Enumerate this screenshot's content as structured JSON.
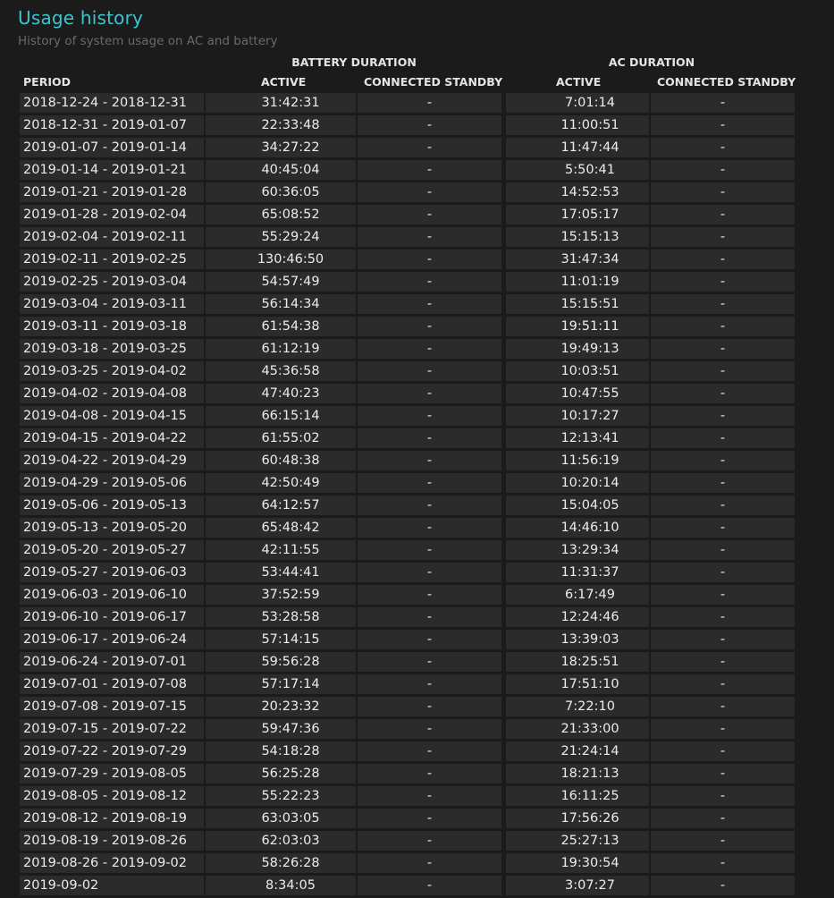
{
  "header": {
    "title": "Usage history",
    "subtitle": "History of system usage on AC and battery"
  },
  "table": {
    "group_battery": "BATTERY DURATION",
    "group_ac": "AC DURATION",
    "columns": {
      "period": "PERIOD",
      "battery_active": "ACTIVE",
      "battery_standby": "CONNECTED STANDBY",
      "ac_active": "ACTIVE",
      "ac_standby": "CONNECTED STANDBY"
    },
    "rows": [
      {
        "period": "2018-12-24 - 2018-12-31",
        "battery_active": "31:42:31",
        "battery_standby": "-",
        "ac_active": "7:01:14",
        "ac_standby": "-"
      },
      {
        "period": "2018-12-31 - 2019-01-07",
        "battery_active": "22:33:48",
        "battery_standby": "-",
        "ac_active": "11:00:51",
        "ac_standby": "-"
      },
      {
        "period": "2019-01-07 - 2019-01-14",
        "battery_active": "34:27:22",
        "battery_standby": "-",
        "ac_active": "11:47:44",
        "ac_standby": "-"
      },
      {
        "period": "2019-01-14 - 2019-01-21",
        "battery_active": "40:45:04",
        "battery_standby": "-",
        "ac_active": "5:50:41",
        "ac_standby": "-"
      },
      {
        "period": "2019-01-21 - 2019-01-28",
        "battery_active": "60:36:05",
        "battery_standby": "-",
        "ac_active": "14:52:53",
        "ac_standby": "-"
      },
      {
        "period": "2019-01-28 - 2019-02-04",
        "battery_active": "65:08:52",
        "battery_standby": "-",
        "ac_active": "17:05:17",
        "ac_standby": "-"
      },
      {
        "period": "2019-02-04 - 2019-02-11",
        "battery_active": "55:29:24",
        "battery_standby": "-",
        "ac_active": "15:15:13",
        "ac_standby": "-"
      },
      {
        "period": "2019-02-11 - 2019-02-25",
        "battery_active": "130:46:50",
        "battery_standby": "-",
        "ac_active": "31:47:34",
        "ac_standby": "-"
      },
      {
        "period": "2019-02-25 - 2019-03-04",
        "battery_active": "54:57:49",
        "battery_standby": "-",
        "ac_active": "11:01:19",
        "ac_standby": "-"
      },
      {
        "period": "2019-03-04 - 2019-03-11",
        "battery_active": "56:14:34",
        "battery_standby": "-",
        "ac_active": "15:15:51",
        "ac_standby": "-"
      },
      {
        "period": "2019-03-11 - 2019-03-18",
        "battery_active": "61:54:38",
        "battery_standby": "-",
        "ac_active": "19:51:11",
        "ac_standby": "-"
      },
      {
        "period": "2019-03-18 - 2019-03-25",
        "battery_active": "61:12:19",
        "battery_standby": "-",
        "ac_active": "19:49:13",
        "ac_standby": "-"
      },
      {
        "period": "2019-03-25 - 2019-04-02",
        "battery_active": "45:36:58",
        "battery_standby": "-",
        "ac_active": "10:03:51",
        "ac_standby": "-"
      },
      {
        "period": "2019-04-02 - 2019-04-08",
        "battery_active": "47:40:23",
        "battery_standby": "-",
        "ac_active": "10:47:55",
        "ac_standby": "-"
      },
      {
        "period": "2019-04-08 - 2019-04-15",
        "battery_active": "66:15:14",
        "battery_standby": "-",
        "ac_active": "10:17:27",
        "ac_standby": "-"
      },
      {
        "period": "2019-04-15 - 2019-04-22",
        "battery_active": "61:55:02",
        "battery_standby": "-",
        "ac_active": "12:13:41",
        "ac_standby": "-"
      },
      {
        "period": "2019-04-22 - 2019-04-29",
        "battery_active": "60:48:38",
        "battery_standby": "-",
        "ac_active": "11:56:19",
        "ac_standby": "-"
      },
      {
        "period": "2019-04-29 - 2019-05-06",
        "battery_active": "42:50:49",
        "battery_standby": "-",
        "ac_active": "10:20:14",
        "ac_standby": "-"
      },
      {
        "period": "2019-05-06 - 2019-05-13",
        "battery_active": "64:12:57",
        "battery_standby": "-",
        "ac_active": "15:04:05",
        "ac_standby": "-"
      },
      {
        "period": "2019-05-13 - 2019-05-20",
        "battery_active": "65:48:42",
        "battery_standby": "-",
        "ac_active": "14:46:10",
        "ac_standby": "-"
      },
      {
        "period": "2019-05-20 - 2019-05-27",
        "battery_active": "42:11:55",
        "battery_standby": "-",
        "ac_active": "13:29:34",
        "ac_standby": "-"
      },
      {
        "period": "2019-05-27 - 2019-06-03",
        "battery_active": "53:44:41",
        "battery_standby": "-",
        "ac_active": "11:31:37",
        "ac_standby": "-"
      },
      {
        "period": "2019-06-03 - 2019-06-10",
        "battery_active": "37:52:59",
        "battery_standby": "-",
        "ac_active": "6:17:49",
        "ac_standby": "-"
      },
      {
        "period": "2019-06-10 - 2019-06-17",
        "battery_active": "53:28:58",
        "battery_standby": "-",
        "ac_active": "12:24:46",
        "ac_standby": "-"
      },
      {
        "period": "2019-06-17 - 2019-06-24",
        "battery_active": "57:14:15",
        "battery_standby": "-",
        "ac_active": "13:39:03",
        "ac_standby": "-"
      },
      {
        "period": "2019-06-24 - 2019-07-01",
        "battery_active": "59:56:28",
        "battery_standby": "-",
        "ac_active": "18:25:51",
        "ac_standby": "-"
      },
      {
        "period": "2019-07-01 - 2019-07-08",
        "battery_active": "57:17:14",
        "battery_standby": "-",
        "ac_active": "17:51:10",
        "ac_standby": "-"
      },
      {
        "period": "2019-07-08 - 2019-07-15",
        "battery_active": "20:23:32",
        "battery_standby": "-",
        "ac_active": "7:22:10",
        "ac_standby": "-"
      },
      {
        "period": "2019-07-15 - 2019-07-22",
        "battery_active": "59:47:36",
        "battery_standby": "-",
        "ac_active": "21:33:00",
        "ac_standby": "-"
      },
      {
        "period": "2019-07-22 - 2019-07-29",
        "battery_active": "54:18:28",
        "battery_standby": "-",
        "ac_active": "21:24:14",
        "ac_standby": "-"
      },
      {
        "period": "2019-07-29 - 2019-08-05",
        "battery_active": "56:25:28",
        "battery_standby": "-",
        "ac_active": "18:21:13",
        "ac_standby": "-"
      },
      {
        "period": "2019-08-05 - 2019-08-12",
        "battery_active": "55:22:23",
        "battery_standby": "-",
        "ac_active": "16:11:25",
        "ac_standby": "-"
      },
      {
        "period": "2019-08-12 - 2019-08-19",
        "battery_active": "63:03:05",
        "battery_standby": "-",
        "ac_active": "17:56:26",
        "ac_standby": "-"
      },
      {
        "period": "2019-08-19 - 2019-08-26",
        "battery_active": "62:03:03",
        "battery_standby": "-",
        "ac_active": "25:27:13",
        "ac_standby": "-"
      },
      {
        "period": "2019-08-26 - 2019-09-02",
        "battery_active": "58:26:28",
        "battery_standby": "-",
        "ac_active": "19:30:54",
        "ac_standby": "-"
      },
      {
        "period": "2019-09-02",
        "battery_active": "8:34:05",
        "battery_standby": "-",
        "ac_active": "3:07:27",
        "ac_standby": "-"
      }
    ]
  }
}
